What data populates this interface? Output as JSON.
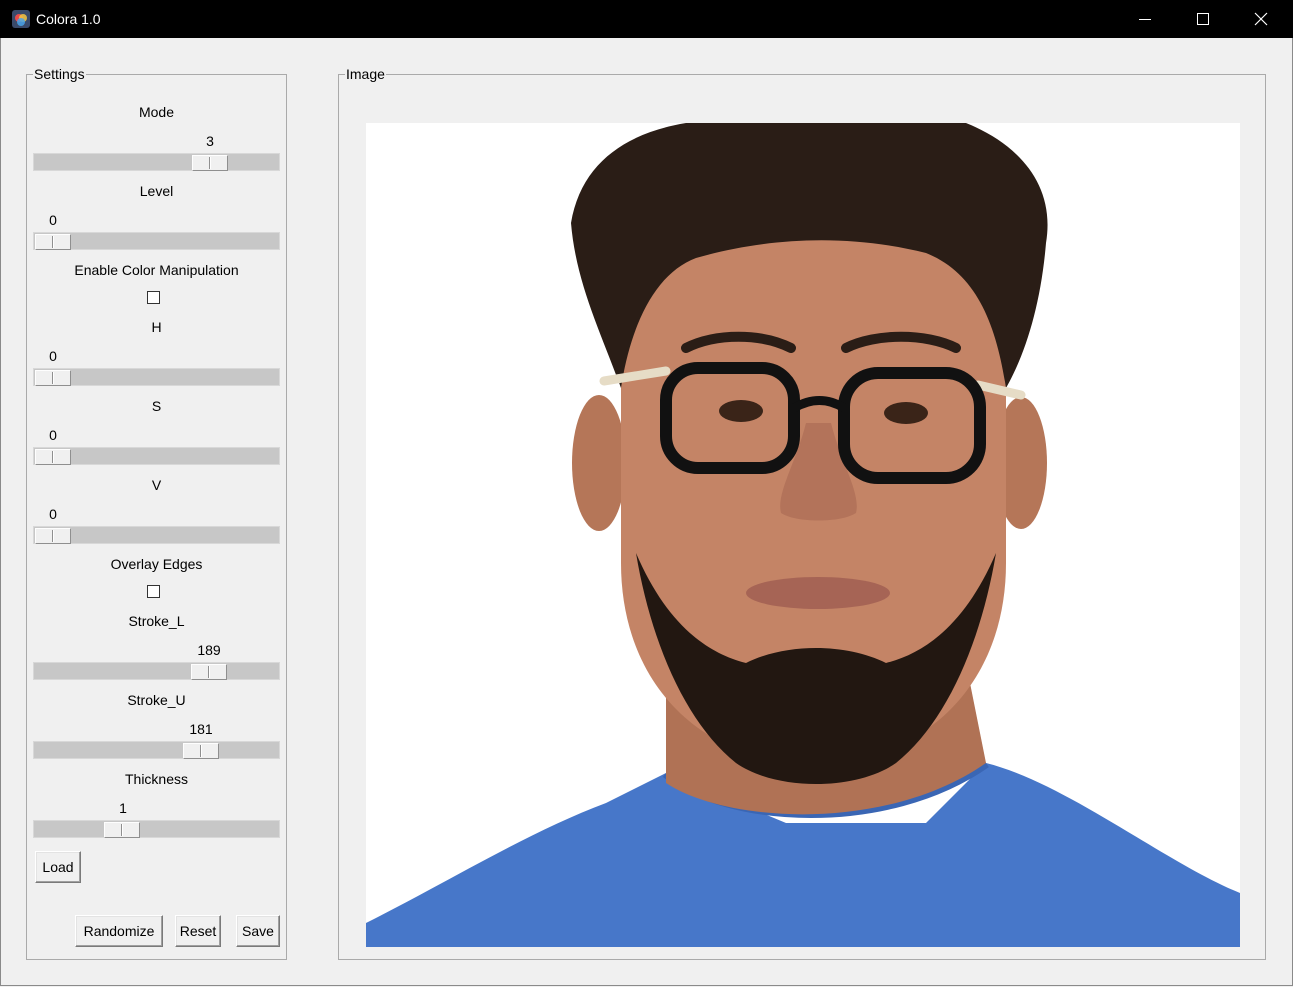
{
  "window": {
    "title": "Colora 1.0",
    "controls": [
      "minimize",
      "maximize",
      "close"
    ]
  },
  "settings": {
    "legend": "Settings",
    "mode": {
      "label": "Mode",
      "value": "3"
    },
    "level": {
      "label": "Level",
      "value": "0"
    },
    "color_manipulation": {
      "label": "Enable Color Manipulation",
      "checked": false
    },
    "h": {
      "label": "H",
      "value": "0"
    },
    "s": {
      "label": "S",
      "value": "0"
    },
    "v": {
      "label": "V",
      "value": "0"
    },
    "overlay_edges": {
      "label": "Overlay Edges",
      "checked": false
    },
    "stroke_l": {
      "label": "Stroke_L",
      "value": "189"
    },
    "stroke_u": {
      "label": "Stroke_U",
      "value": "181"
    },
    "thickness": {
      "label": "Thickness",
      "value": "1"
    },
    "buttons": {
      "load": "Load",
      "randomize": "Randomize",
      "reset": "Reset",
      "save": "Save"
    }
  },
  "image_panel": {
    "legend": "Image",
    "content": "portrait-photo"
  },
  "colors": {
    "titlebar": "#000000",
    "window_bg": "#f0f0f0",
    "slider_trough": "#c7c7c7",
    "shirt": "#4777c9"
  }
}
